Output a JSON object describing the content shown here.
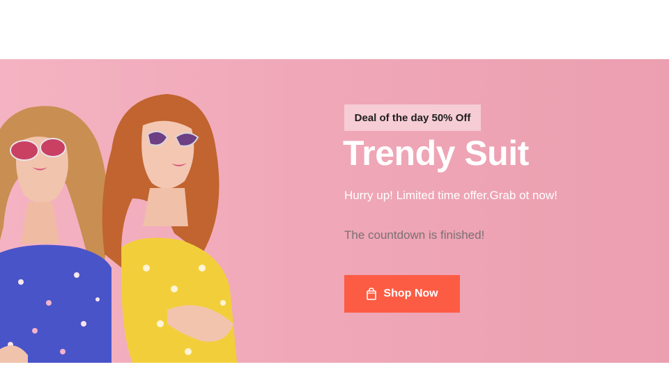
{
  "hero": {
    "badge": "Deal of the day 50% Off",
    "title": "Trendy Suit",
    "subtitle": "Hurry up! Limited time offer.Grab ot now!",
    "countdown": "The countdown is finished!",
    "cta_label": "Shop Now",
    "cta_icon": "shopping-bag-icon",
    "image": "two-models-sunglasses-dresses"
  },
  "colors": {
    "banner_bg": "#f0a8b8",
    "badge_bg": "#f6ccd5",
    "cta_bg": "#fd5c44",
    "title_text": "#ffffff",
    "countdown_text": "#7b6f73"
  }
}
